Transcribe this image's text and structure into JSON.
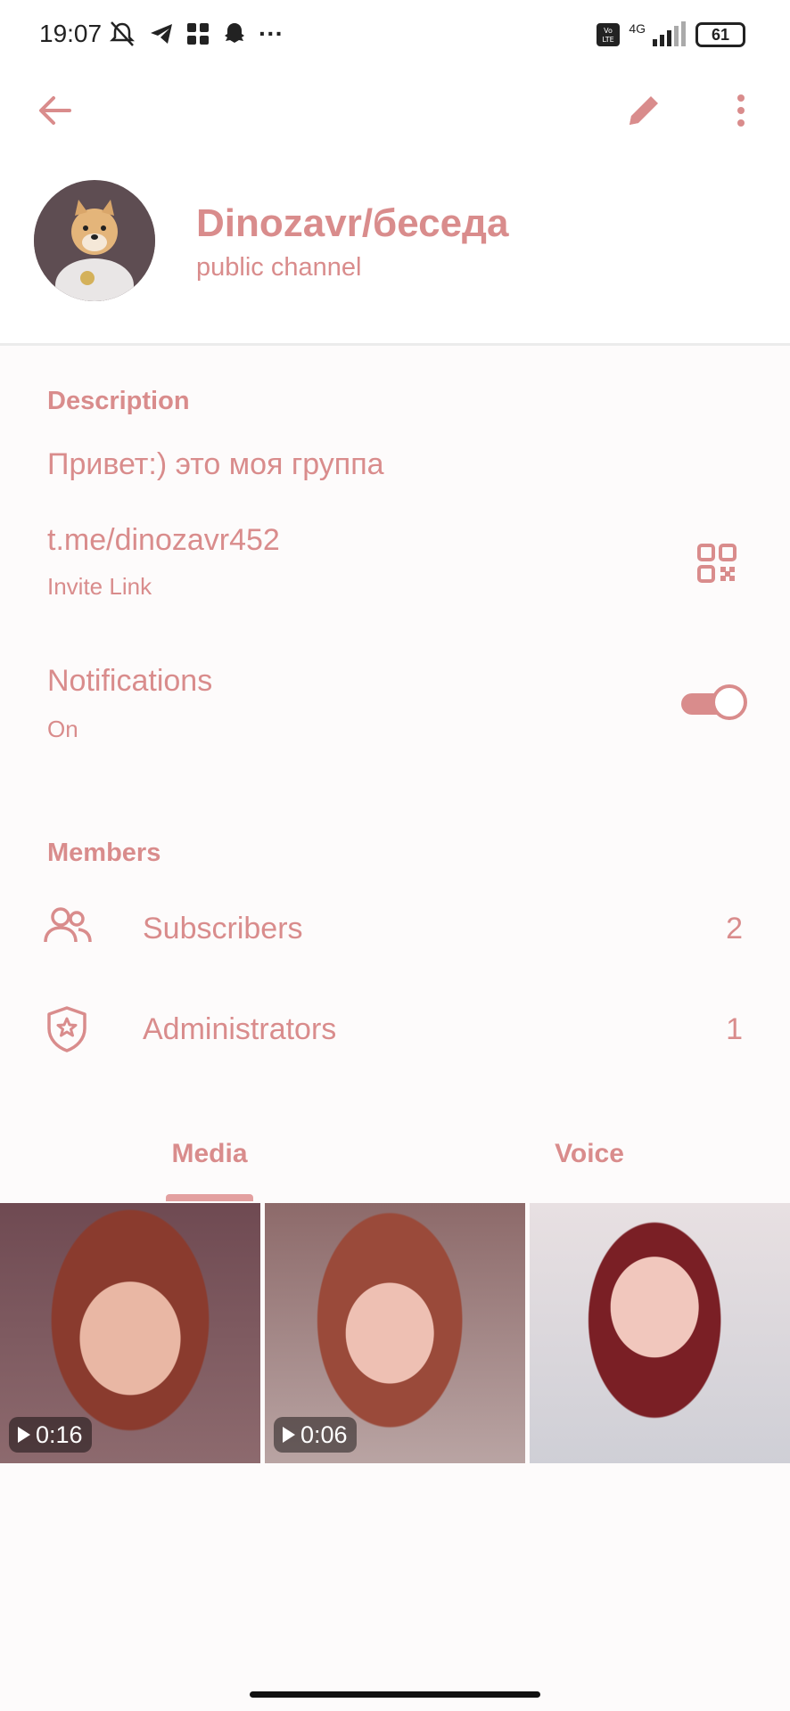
{
  "status_bar": {
    "time": "19:07",
    "battery": "61",
    "network": "4G",
    "volte": "Vo LTE",
    "more": "···"
  },
  "header": {
    "title": "Dinozavr/беседа",
    "subtitle": "public channel"
  },
  "description": {
    "heading": "Description",
    "text": "Привет:) это моя группа",
    "link": "t.me/dinozavr452",
    "link_label": "Invite Link"
  },
  "notifications": {
    "label": "Notifications",
    "value": "On",
    "enabled": true
  },
  "members": {
    "heading": "Members",
    "rows": [
      {
        "label": "Subscribers",
        "count": "2",
        "icon": "people-icon"
      },
      {
        "label": "Administrators",
        "count": "1",
        "icon": "shield-star-icon"
      }
    ]
  },
  "tabs": [
    {
      "label": "Media",
      "active": true
    },
    {
      "label": "Voice",
      "active": false
    }
  ],
  "media": [
    {
      "duration": "0:16",
      "is_video": true
    },
    {
      "duration": "0:06",
      "is_video": true
    },
    {
      "duration": "",
      "is_video": false
    }
  ],
  "colors": {
    "accent": "#d98c8c",
    "background": "#fdfbfb"
  }
}
